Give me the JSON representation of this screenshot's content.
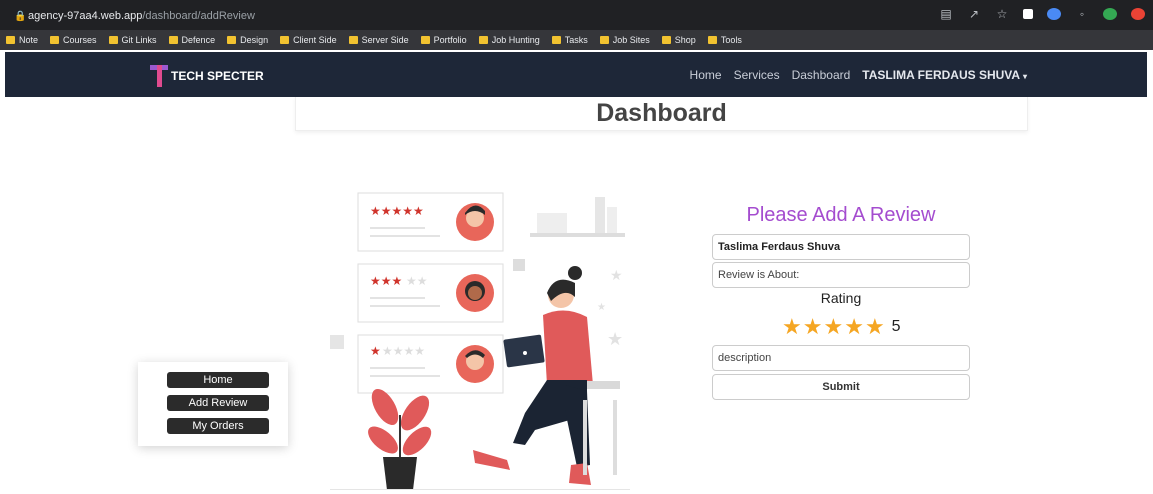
{
  "browser": {
    "url_host": "agency-97aa4.web.app",
    "url_path": "/dashboard/addReview",
    "bookmarks": [
      "Note",
      "Courses",
      "Git Links",
      "Defence",
      "Design",
      "Client Side",
      "Server Side",
      "Portfolio",
      "Job Hunting",
      "Tasks",
      "Job Sites",
      "Shop",
      "Tools"
    ]
  },
  "navbar": {
    "brand": "TECH SPECTER",
    "links": [
      "Home",
      "Services",
      "Dashboard"
    ],
    "user": "TASLIMA FERDAUS SHUVA",
    "caret": "▾"
  },
  "page": {
    "title": "Dashboard"
  },
  "sidebar": {
    "items": [
      "Home",
      "Add Review",
      "My Orders"
    ]
  },
  "form": {
    "title": "Please Add A Review",
    "name_value": "Taslima Ferdaus Shuva",
    "about_placeholder": "Review is About:",
    "rating_label": "Rating",
    "rating_value": 5,
    "rating_text": "5",
    "description_placeholder": "description",
    "submit_label": "Submit"
  },
  "colors": {
    "accent": "#a44ccf",
    "star": "#f5a623",
    "navbar": "#1e2738"
  },
  "illustration": {
    "card_ratings": [
      5,
      3,
      1
    ]
  }
}
